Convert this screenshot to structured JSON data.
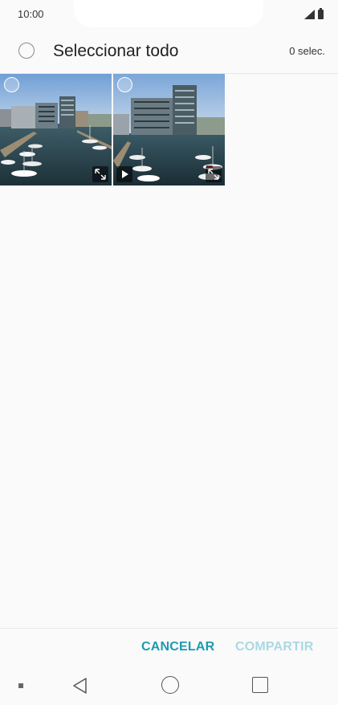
{
  "status_bar": {
    "time": "10:00",
    "icons": [
      "signal-icon",
      "battery-icon"
    ]
  },
  "header": {
    "select_all_label": "Seleccionar todo",
    "selected_count": "0 selec."
  },
  "gallery": {
    "items": [
      {
        "type": "image",
        "selected": false,
        "overlay_icons": [
          "expand-icon"
        ]
      },
      {
        "type": "video",
        "selected": false,
        "overlay_icons": [
          "play-icon",
          "expand-icon"
        ]
      }
    ]
  },
  "actions": {
    "cancel_label": "CANCELAR",
    "share_label": "COMPARTIR",
    "share_enabled": false
  },
  "colors": {
    "accent": "#1b9bb1",
    "accent_disabled": "#a9d9e2",
    "background": "#fafafa"
  },
  "navigation": {
    "icons": [
      "nav-dot-icon",
      "back-icon",
      "home-icon",
      "recents-icon"
    ]
  }
}
